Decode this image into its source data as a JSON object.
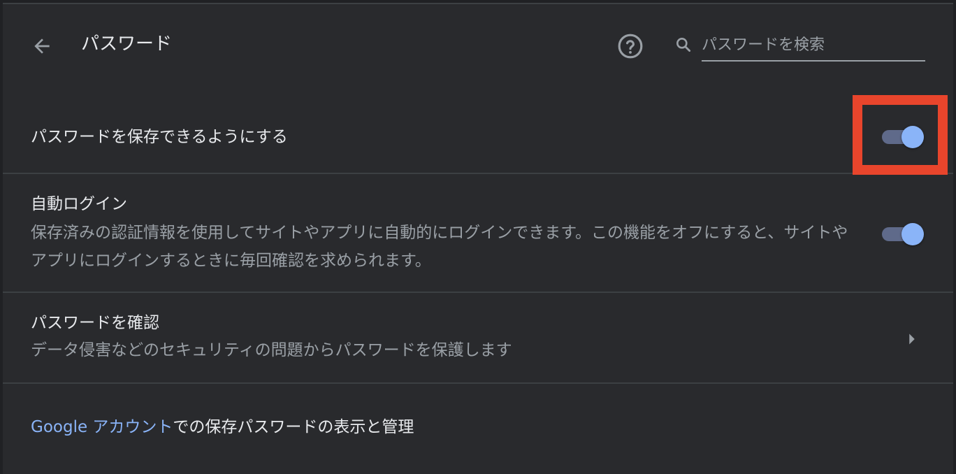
{
  "header": {
    "title": "パスワード",
    "back_icon": "arrow-left-icon",
    "help_icon": "help-circle-icon",
    "search_icon": "search-icon",
    "search_placeholder": "パスワードを検索",
    "search_value": ""
  },
  "settings": {
    "save_passwords": {
      "label": "パスワードを保存できるようにする",
      "enabled": true
    },
    "auto_signin": {
      "label": "自動ログイン",
      "description": "保存済みの認証情報を使用してサイトやアプリに自動的にログインできます。この機能をオフにすると、サイトやアプリにログインするときに毎回確認を求められます。",
      "enabled": true
    },
    "password_check": {
      "label": "パスワードを確認",
      "description": "データ侵害などのセキュリティの問題からパスワードを保護します",
      "chevron_icon": "chevron-right-icon"
    }
  },
  "footer": {
    "link_text": "Google アカウント",
    "suffix_text": "での保存パスワードの表示と管理"
  },
  "colors": {
    "background": "#292a2d",
    "accent": "#8ab4f8",
    "highlight": "#e8452c"
  }
}
